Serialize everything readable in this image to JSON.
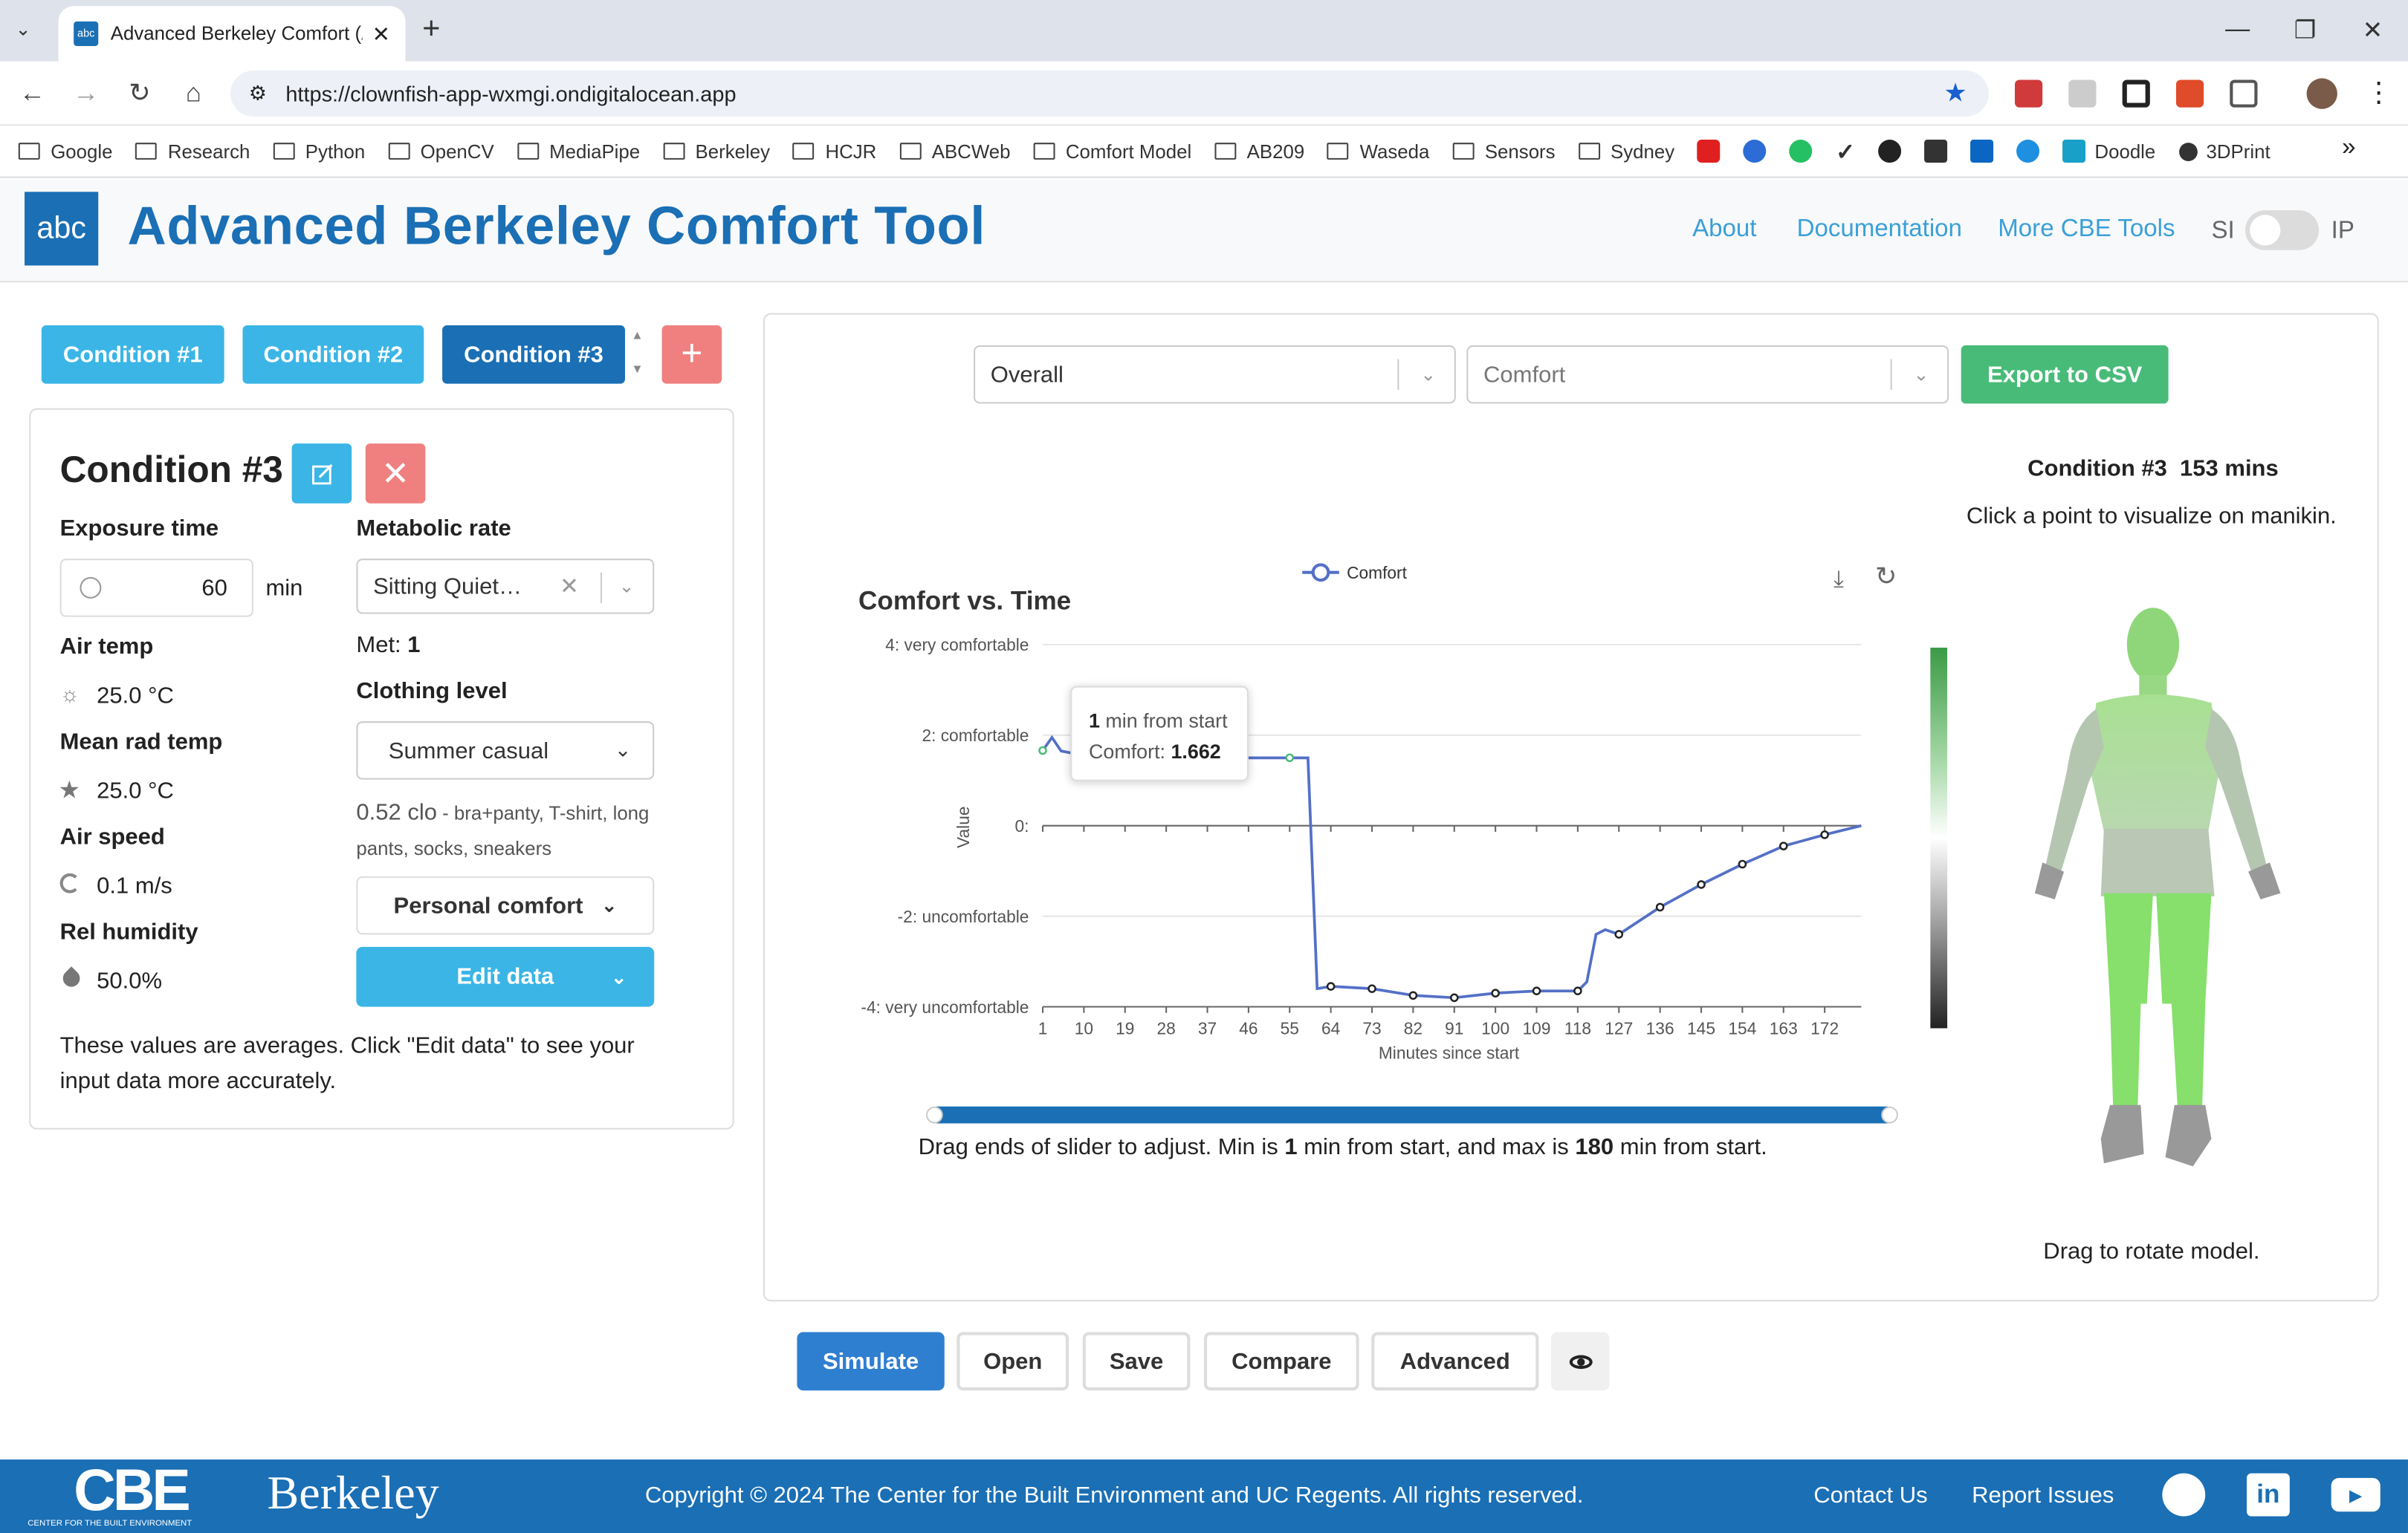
{
  "browser": {
    "tab_title": "Advanced Berkeley Comfort (AE",
    "url": "https://clownfish-app-wxmgi.ondigitalocean.app",
    "bookmarks": [
      "Google",
      "Research",
      "Python",
      "OpenCV",
      "MediaPipe",
      "Berkeley",
      "HCJR",
      "ABCWeb",
      "Comfort Model",
      "AB209",
      "Waseda",
      "Sensors",
      "Sydney"
    ],
    "bookmarks_tail": [
      "Doodle",
      "3DPrint"
    ]
  },
  "header": {
    "logo": "abc",
    "title": "Advanced Berkeley Comfort Tool",
    "nav": [
      "About",
      "Documentation",
      "More CBE Tools"
    ],
    "unit_si": "SI",
    "unit_ip": "IP"
  },
  "conditions": {
    "tabs": [
      "Condition #1",
      "Condition #2",
      "Condition #3"
    ],
    "add": "+"
  },
  "condition_panel": {
    "title": "Condition #3",
    "exposure_label": "Exposure time",
    "exposure_value": "60",
    "exposure_unit": "min",
    "air_temp_label": "Air temp",
    "air_temp": "25.0 °C",
    "mrt_label": "Mean rad temp",
    "mrt": "25.0 °C",
    "air_speed_label": "Air speed",
    "air_speed": "0.1 m/s",
    "rh_label": "Rel humidity",
    "rh": "50.0%",
    "met_label": "Metabolic rate",
    "met_select": "Sitting Quiet…",
    "met_prefix": "Met: ",
    "met_value": "1",
    "clo_label": "Clothing level",
    "clo_select": "Summer casual",
    "clo_value": "0.52 clo",
    "clo_sep": " - ",
    "clo_desc": "bra+panty, T-shirt, long pants, socks, sneakers",
    "personal_comfort": "Personal comfort",
    "edit_data": "Edit data",
    "note": "These values are averages. Click \"Edit data\" to see your input data more accurately."
  },
  "controls": {
    "select1": "Overall",
    "select2": "Comfort",
    "export": "Export to CSV"
  },
  "tooltip": {
    "bold": "1",
    "line1": " min from start",
    "line2_prefix": "Comfort: ",
    "line2_val": "1.662"
  },
  "slider": {
    "p1": "Drag ends of slider to adjust. Min is ",
    "min": "1",
    "p2": " min from start, and max is ",
    "max": "180",
    "p3": " min from start."
  },
  "manikin": {
    "title": "Condition #3  153 mins",
    "hint": "Click a point to visualize on manikin.",
    "rotate": "Drag to rotate model."
  },
  "actions": [
    "Simulate",
    "Open",
    "Save",
    "Compare",
    "Advanced"
  ],
  "footer": {
    "cbe": "CBE",
    "cbe_sub": "CENTER FOR THE BUILT ENVIRONMENT",
    "berkeley": "Berkeley",
    "copyright": "Copyright © 2024 The Center for the Built Environment and UC Regents. All rights reserved.",
    "contact": "Contact Us",
    "report": "Report Issues"
  },
  "colors": {
    "primary": "#1a6fb5",
    "light": "#3ab5e6",
    "green": "#48bb78",
    "danger": "#f08080",
    "line": "#5470c6"
  },
  "chart_data": {
    "type": "line",
    "title": "Comfort vs. Time",
    "xlabel": "Minutes since start",
    "ylabel": "Value",
    "ylim": [
      -4,
      4
    ],
    "xlim": [
      1,
      180
    ],
    "legend": "Comfort",
    "legend_position": "top",
    "y_ticks": [
      {
        "v": 4,
        "label": "4: very comfortable"
      },
      {
        "v": 2,
        "label": "2: comfortable"
      },
      {
        "v": 0,
        "label": "0:"
      },
      {
        "v": -2,
        "label": "-2: uncomfortable"
      },
      {
        "v": -4,
        "label": "-4: very uncomfortable"
      }
    ],
    "x_ticks": [
      1,
      10,
      19,
      28,
      37,
      46,
      55,
      64,
      73,
      82,
      91,
      100,
      109,
      118,
      127,
      136,
      145,
      154,
      163,
      172
    ],
    "series": [
      {
        "name": "Comfort",
        "points": [
          [
            1,
            1.66
          ],
          [
            3,
            1.95
          ],
          [
            5,
            1.65
          ],
          [
            10,
            1.55
          ],
          [
            19,
            1.52
          ],
          [
            28,
            1.5
          ],
          [
            37,
            1.5
          ],
          [
            46,
            1.5
          ],
          [
            55,
            1.5
          ],
          [
            59,
            1.5
          ],
          [
            61,
            -3.6
          ],
          [
            64,
            -3.55
          ],
          [
            73,
            -3.6
          ],
          [
            82,
            -3.75
          ],
          [
            91,
            -3.8
          ],
          [
            100,
            -3.7
          ],
          [
            109,
            -3.65
          ],
          [
            118,
            -3.65
          ],
          [
            120,
            -3.45
          ],
          [
            122,
            -2.4
          ],
          [
            124,
            -2.3
          ],
          [
            127,
            -2.4
          ],
          [
            136,
            -1.8
          ],
          [
            145,
            -1.3
          ],
          [
            154,
            -0.85
          ],
          [
            163,
            -0.45
          ],
          [
            172,
            -0.2
          ],
          [
            180,
            0
          ]
        ],
        "markers": [
          [
            1,
            1.66
          ],
          [
            55,
            1.5
          ],
          [
            64,
            -3.55
          ],
          [
            73,
            -3.6
          ],
          [
            82,
            -3.75
          ],
          [
            91,
            -3.8
          ],
          [
            100,
            -3.7
          ],
          [
            109,
            -3.65
          ],
          [
            118,
            -3.65
          ],
          [
            127,
            -2.4
          ],
          [
            136,
            -1.8
          ],
          [
            145,
            -1.3
          ],
          [
            154,
            -0.85
          ],
          [
            163,
            -0.45
          ],
          [
            172,
            -0.2
          ]
        ]
      }
    ]
  }
}
